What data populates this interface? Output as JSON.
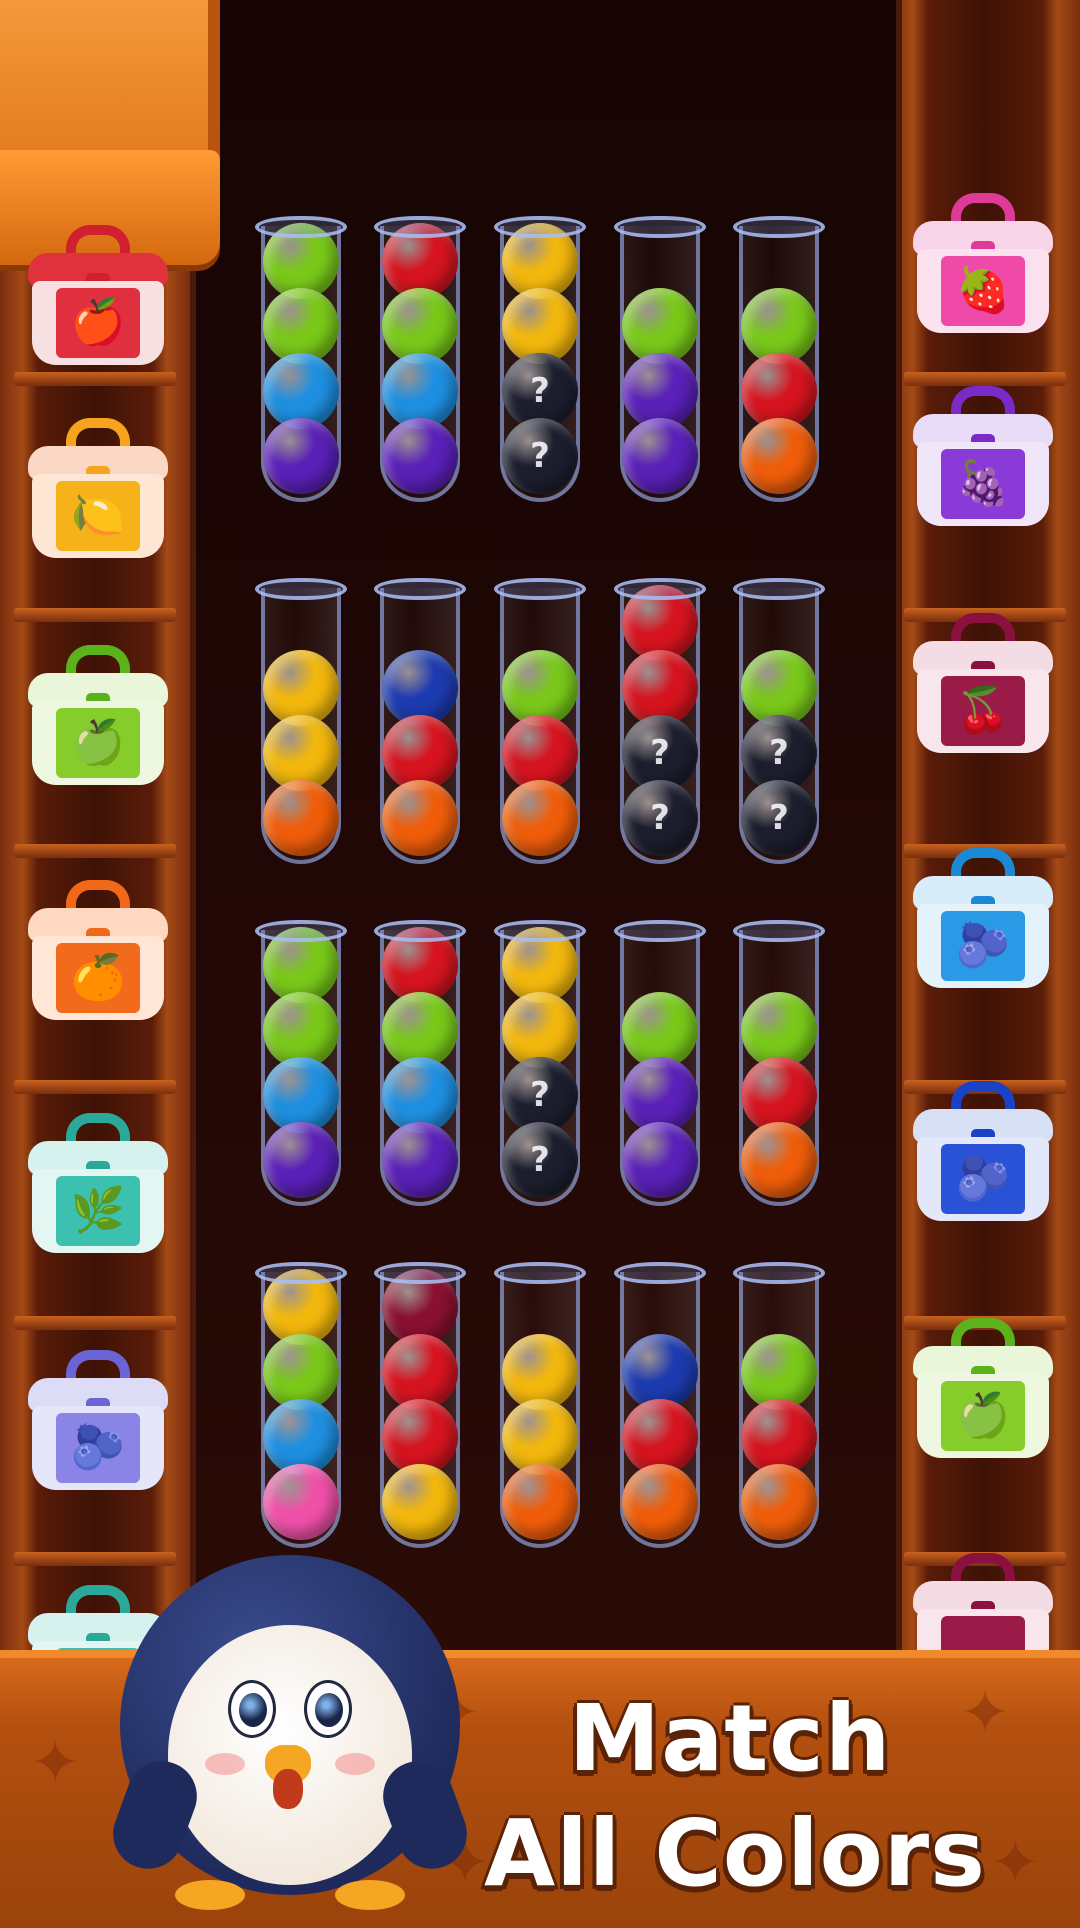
{
  "banner": {
    "title_line1": "Match",
    "title_line2": "All Colors"
  },
  "colors": {
    "red": "#d6141f",
    "lime": "#79c81a",
    "blue": "#1e8fe0",
    "purple": "#5a20b8",
    "yellow": "#f2b70c",
    "orange": "#ef5d0a",
    "mystery": "#1c1e2e",
    "navy": "#1d3bb0",
    "maroon": "#8a1030",
    "pink": "#f050a8"
  },
  "tube_rows": [
    {
      "tubes": [
        {
          "balls": [
            "lime",
            "lime",
            "blue",
            "purple"
          ]
        },
        {
          "balls": [
            "red",
            "lime",
            "blue",
            "purple"
          ]
        },
        {
          "balls": [
            "yellow",
            "yellow",
            "mystery",
            "mystery"
          ]
        },
        {
          "balls": [
            "lime",
            "purple",
            "purple"
          ]
        },
        {
          "balls": [
            "lime",
            "red",
            "orange"
          ]
        }
      ]
    },
    {
      "tubes": [
        {
          "balls": [
            "yellow",
            "yellow",
            "orange"
          ]
        },
        {
          "balls": [
            "navy",
            "red",
            "orange"
          ]
        },
        {
          "balls": [
            "lime",
            "red",
            "orange"
          ]
        },
        {
          "balls": [
            "red",
            "red",
            "mystery",
            "mystery"
          ]
        },
        {
          "balls": [
            "lime",
            "mystery",
            "mystery"
          ]
        }
      ]
    },
    {
      "tubes": [
        {
          "balls": [
            "lime",
            "lime",
            "blue",
            "purple"
          ]
        },
        {
          "balls": [
            "red",
            "lime",
            "blue",
            "purple"
          ]
        },
        {
          "balls": [
            "yellow",
            "yellow",
            "mystery",
            "mystery"
          ]
        },
        {
          "balls": [
            "lime",
            "purple",
            "purple"
          ]
        },
        {
          "balls": [
            "lime",
            "red",
            "orange"
          ]
        }
      ]
    },
    {
      "tubes": [
        {
          "balls": [
            "yellow",
            "lime",
            "blue",
            "pink"
          ]
        },
        {
          "balls": [
            "maroon",
            "red",
            "red",
            "yellow"
          ]
        },
        {
          "balls": [
            "yellow",
            "yellow",
            "orange"
          ]
        },
        {
          "balls": [
            "navy",
            "red",
            "orange"
          ]
        },
        {
          "balls": [
            "lime",
            "red",
            "orange"
          ]
        }
      ]
    }
  ],
  "mystery_symbol": "?",
  "left_jars": [
    {
      "name": "apple-jar",
      "fruit": "🍎",
      "lid": "#e0323c",
      "body": "#f7e0e2",
      "label": "#e03040",
      "handle": "#d02030"
    },
    {
      "name": "lemon-jar",
      "fruit": "🍋",
      "lid": "#fbd8c4",
      "body": "#fde6d4",
      "label": "#f7b21a",
      "handle": "#f6a41e"
    },
    {
      "name": "green-apple-jar",
      "fruit": "🍏",
      "lid": "#eaf6da",
      "body": "#eef7e0",
      "label": "#86cc2a",
      "handle": "#5cb21a"
    },
    {
      "name": "orange-jar",
      "fruit": "🍊",
      "lid": "#ffd8c2",
      "body": "#ffe6d6",
      "label": "#f26a1c",
      "handle": "#f06818"
    },
    {
      "name": "mint-jar",
      "fruit": "🌿",
      "lid": "#d6f2ee",
      "body": "#e4f6f2",
      "label": "#3cc0b0",
      "handle": "#2aa89a"
    },
    {
      "name": "blackberry-jar",
      "fruit": "🫐",
      "lid": "#dcdcf6",
      "body": "#e6e6fa",
      "label": "#8a84e6",
      "handle": "#6a64d6"
    },
    {
      "name": "partial-jar-left",
      "fruit": "",
      "lid": "#d6f2ee",
      "body": "#e4f6f2",
      "label": "#3cc0b0",
      "handle": "#2aa89a"
    }
  ],
  "right_jars": [
    {
      "name": "strawberry-jar",
      "fruit": "🍓",
      "lid": "#f8d4e8",
      "body": "#fbe2ee",
      "label": "#f04aa8",
      "handle": "#e03a98"
    },
    {
      "name": "grape-jar",
      "fruit": "🍇",
      "lid": "#e8dcf6",
      "body": "#f0e6fa",
      "label": "#8a3ad6",
      "handle": "#7a2ac6"
    },
    {
      "name": "cherry-jar",
      "fruit": "🍒",
      "lid": "#f4dce4",
      "body": "#f8e6ec",
      "label": "#9a1a48",
      "handle": "#8a1040"
    },
    {
      "name": "blueberry-jar",
      "fruit": "🫐",
      "lid": "#d8ecfa",
      "body": "#e4f2fc",
      "label": "#2a9ae6",
      "handle": "#1a8ad6"
    },
    {
      "name": "blackberry-jar",
      "fruit": "🫐",
      "lid": "#d8e0f6",
      "body": "#e2e8fa",
      "label": "#2a52d6",
      "handle": "#1a42c6"
    },
    {
      "name": "green-apple-jar",
      "fruit": "🍏",
      "lid": "#eaf6da",
      "body": "#eef7e0",
      "label": "#86cc2a",
      "handle": "#5cb21a"
    },
    {
      "name": "partial-jar-right",
      "fruit": "",
      "lid": "#f4dce4",
      "body": "#f8e6ec",
      "label": "#9a1a48",
      "handle": "#8a1040"
    }
  ]
}
